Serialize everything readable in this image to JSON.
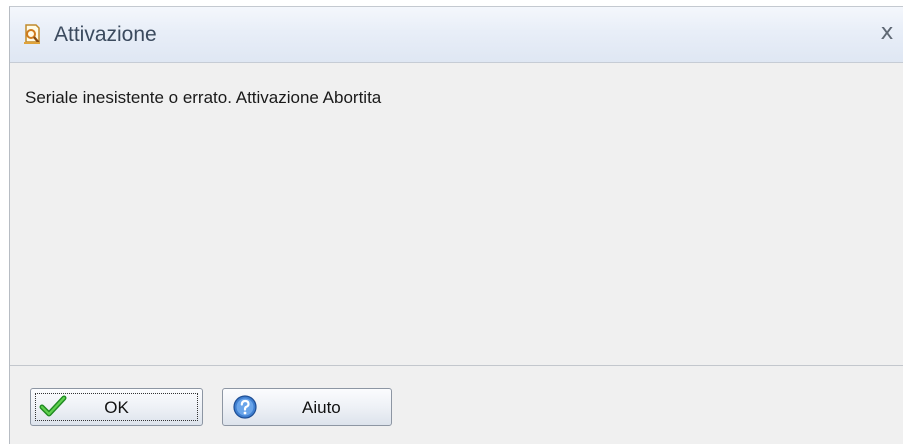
{
  "dialog": {
    "title": "Attivazione",
    "close_glyph": "x",
    "message": "Seriale inesistente o errato. Attivazione Abortita"
  },
  "buttons": {
    "ok": {
      "label": "OK",
      "icon": "checkmark-icon"
    },
    "help": {
      "label": "Aiuto",
      "icon": "help-icon"
    }
  },
  "colors": {
    "titlebar": "#e8eef8",
    "body": "#f0f0f0",
    "ok_check": "#2ea12e",
    "help_icon": "#3f7fd0"
  }
}
